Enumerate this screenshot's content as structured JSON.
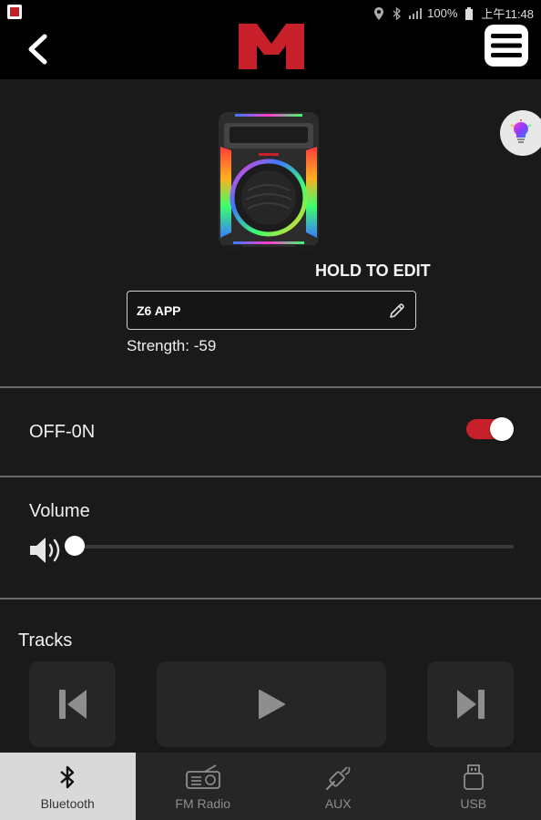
{
  "status_bar": {
    "battery": "100%",
    "time": "上午11:48",
    "icons": [
      "app-notification-icon",
      "location-icon",
      "bluetooth-icon",
      "signal-icon",
      "battery-icon"
    ]
  },
  "header": {
    "back_icon": "chevron-left-icon",
    "logo": "monster-logo",
    "menu_icon": "hamburger-menu-icon"
  },
  "device": {
    "hold_to_edit": "HOLD TO EDIT",
    "name": "Z6 APP",
    "strength": "Strength: -59",
    "light_icon": "lightbulb-icon"
  },
  "power": {
    "label": "OFF-0N",
    "on": true
  },
  "volume": {
    "label": "Volume",
    "level": 0.0
  },
  "tracks": {
    "label": "Tracks",
    "controls": [
      "previous-icon",
      "play-icon",
      "next-icon"
    ]
  },
  "bottom_nav": {
    "items": [
      {
        "label": "Bluetooth",
        "icon": "bluetooth-icon",
        "active": true
      },
      {
        "label": "FM Radio",
        "icon": "radio-icon",
        "active": false
      },
      {
        "label": "AUX",
        "icon": "aux-cable-icon",
        "active": false
      },
      {
        "label": "USB",
        "icon": "usb-icon",
        "active": false
      }
    ]
  },
  "colors": {
    "accent": "#c8202a",
    "background": "#1a1a1a",
    "header": "#000000",
    "nav_background": "#262626",
    "nav_active": "#d9d9d9"
  }
}
